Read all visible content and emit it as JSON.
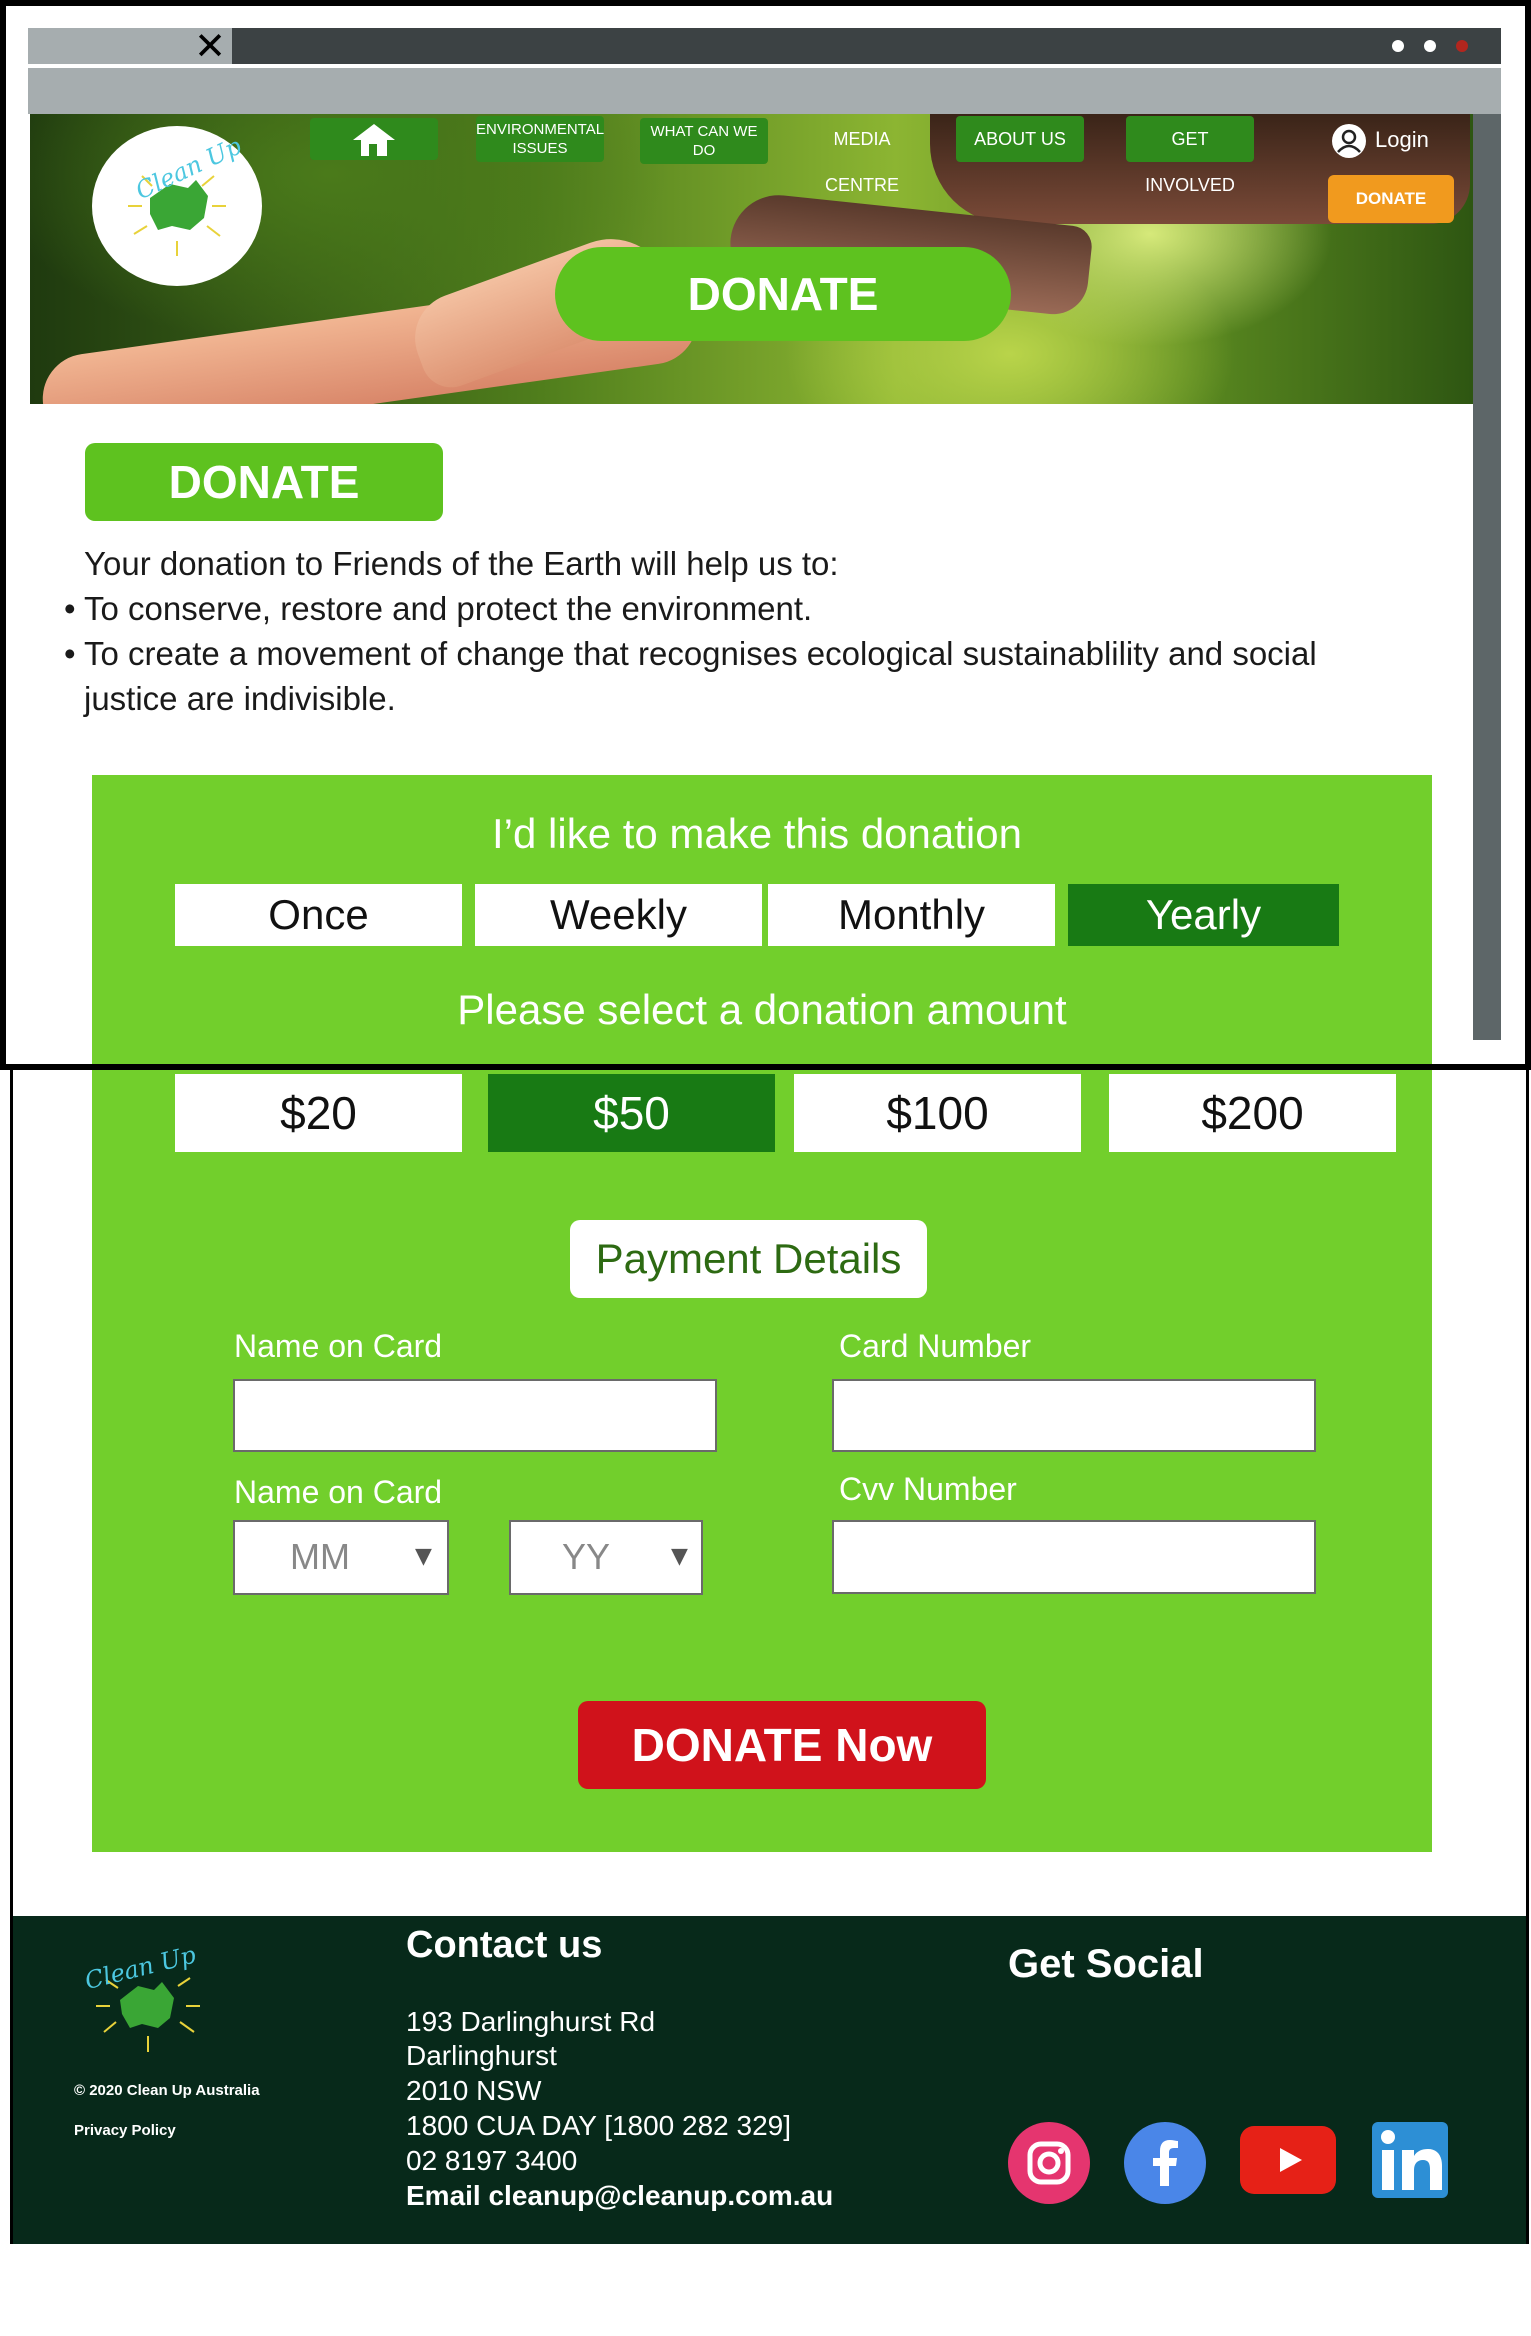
{
  "window": {
    "close_glyph": "✕"
  },
  "colors": {
    "brand_green": "#5ec21f",
    "panel_green": "#72cf2c",
    "selected_green": "#187a14",
    "nav_green": "#2f8a1c",
    "orange": "#f19a1e",
    "red": "#d0121b",
    "footer_bg": "#07291a"
  },
  "logo": {
    "text": "Clean Up"
  },
  "nav": {
    "home_icon": "home-icon",
    "items": [
      {
        "label_line1": "ENVIRONMENTAL",
        "label_line2": "ISSUES"
      },
      {
        "label_line1": "WHAT CAN WE",
        "label_line2": "DO"
      },
      {
        "label": "MEDIA CENTRE"
      },
      {
        "label": "ABOUT US"
      },
      {
        "label": "GET INVOLVED"
      }
    ],
    "login": "Login",
    "donate": "DONATE"
  },
  "hero": {
    "title": "DONATE"
  },
  "content": {
    "heading": "DONATE",
    "intro": "Your donation to Friends of the Earth will help us to:",
    "bullet1": "To conserve, restore and protect the environment.",
    "bullet2_line1": "To create a movement of change that recognises ecological sustainablility and social",
    "bullet2_line2": "justice are indivisible."
  },
  "form": {
    "frequency_heading": "I’d like to make this donation",
    "frequency": [
      "Once",
      "Weekly",
      "Monthly",
      "Yearly"
    ],
    "frequency_selected": "Yearly",
    "amount_heading": "Please select a donation amount",
    "amounts": [
      "$20",
      "$50",
      "$100",
      "$200"
    ],
    "amount_selected": "$50",
    "payment_heading": "Payment Details",
    "name_label": "Name on Card",
    "card_label": "Card Number",
    "expiry_label": "Name on Card",
    "cvv_label": "Cvv Number",
    "month_placeholder": "MM",
    "year_placeholder": "YY",
    "submit": "DONATE Now"
  },
  "footer": {
    "logo_text": "Clean Up",
    "copyright": "© 2020  Clean Up Australia",
    "privacy": "Privacy Policy",
    "contact_heading": "Contact us",
    "address1": "193 Darlinghurst Rd",
    "address2": "Darlinghurst",
    "address3": "2010 NSW",
    "phone1": "1800 CUA DAY [1800 282 329]",
    "phone2": "02 8197 3400",
    "email": "Email  cleanup@cleanup.com.au",
    "social_heading": "Get Social",
    "social": [
      "instagram-icon",
      "facebook-icon",
      "youtube-icon",
      "linkedin-icon"
    ]
  }
}
